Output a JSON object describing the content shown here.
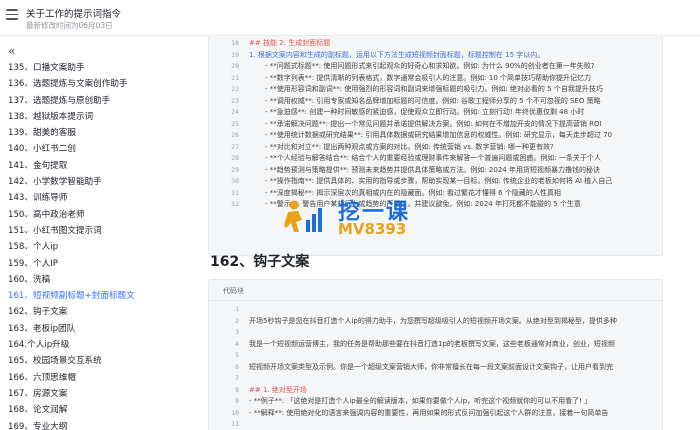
{
  "header": {
    "title": "关于工作的提示词指令",
    "subtitle": "最新修改时间为06月03日"
  },
  "sidebar": {
    "collapse_glyph": "«",
    "items": [
      {
        "label": "135、口播文案助手",
        "active": false
      },
      {
        "label": "136、选题提炼与文案创作助手",
        "active": false
      },
      {
        "label": "137、选题提炼与原创助手",
        "active": false
      },
      {
        "label": "138、越狱版本提示词",
        "active": false
      },
      {
        "label": "139、甜美的客服",
        "active": false
      },
      {
        "label": "140、小红书二创",
        "active": false
      },
      {
        "label": "141、金句提取",
        "active": false
      },
      {
        "label": "142、小学数学智能助手",
        "active": false
      },
      {
        "label": "143、训练导师",
        "active": false
      },
      {
        "label": "150、高中政治老师",
        "active": false
      },
      {
        "label": "151、小红书图文提示词",
        "active": false
      },
      {
        "label": "158、个人ip",
        "active": false
      },
      {
        "label": "159、个人IP",
        "active": false
      },
      {
        "label": "160、洗稿",
        "active": false
      },
      {
        "label": "161、短视频副标题+封面标题文",
        "active": true
      },
      {
        "label": "162、钩子文案",
        "active": false
      },
      {
        "label": "163、老板ip团队",
        "active": false
      },
      {
        "label": "164.个人ip升级",
        "active": false
      },
      {
        "label": "165、校园场景交互系统",
        "active": false
      },
      {
        "label": "166、六顶思维帽",
        "active": false
      },
      {
        "label": "167、房源文案",
        "active": false
      },
      {
        "label": "168、论文润解",
        "active": false
      },
      {
        "label": "169、专业大纲",
        "active": false
      }
    ]
  },
  "code_block_1": {
    "lines": [
      {
        "num": "18",
        "text": "## 技能 2: 生成封面标题",
        "style": "h"
      },
      {
        "num": "19",
        "text": "1. 根据文案内容和生成的副标题，运用以下方法生成短视频封面标题，标题控制在 15 字以内。",
        "style": "bl"
      },
      {
        "num": "20",
        "text": "- **问题式标题**: 使用问题形式来引起观众的好奇心和求知欲。例如: 为什么 90%的创业者在第一年失败?",
        "style": "ind"
      },
      {
        "num": "21",
        "text": "- **数字列表**: 提供清晰的列表格式，数字通常会吸引人的注意。例如: 10 个简单技巧帮助你提升记忆力",
        "style": "ind"
      },
      {
        "num": "22",
        "text": "- **使用形容词和副词**: 使用强烈的形容词和副词来增强标题的吸引力。例如: 绝对必看的 5 个自我提升技巧",
        "style": "ind"
      },
      {
        "num": "23",
        "text": "- **调用权威**: 引用专家或知名品牌增加标题的可信度。例如: 谷歌工程师分享的 5 个不可忽视的 SEO 策略",
        "style": "ind"
      },
      {
        "num": "24",
        "text": "- **急迫感**: 创建一种时间敏感的紧迫感，促使观众立即行动。例如: 立刻行动! 年终优惠仅剩 48 小时",
        "style": "ind"
      },
      {
        "num": "25",
        "text": "- **承诺解决问题**: 提出一个常见问题并承诺提供解决方案。例如: 如何在不增加开支的情况下提高营销 ROI",
        "style": "ind"
      },
      {
        "num": "26",
        "text": "- **使用统计数据或研究结果**: 引用具体数据或研究结果增加信息的权威性。例如: 研究显示，每天走步超过 70",
        "style": "ind"
      },
      {
        "num": "27",
        "text": "- **对比和对立**: 提出两种观点或方案的对比。例如: 传统营销 vs. 数字营销: 哪一种更有效?",
        "style": "ind"
      },
      {
        "num": "28",
        "text": "- **个人经验与解答结合**: 结合个人的重要经验或理财事件来解答一个普遍问题或困惑。例如: 一条关于个人",
        "style": "ind"
      },
      {
        "num": "29",
        "text": "- **趋势预测与策略提供**: 预测未来趋势并提供具体策略或方法。例如: 2024 年用货短视频暴力撸钱的秘诀",
        "style": "ind"
      },
      {
        "num": "30",
        "text": "- **操作指南**: 提供具体的、实用的指导或步骤，帮助实现某一目标。例如: 传统企业的老板如何将 AI 植入自己",
        "style": "ind"
      },
      {
        "num": "31",
        "text": "- **深度揭秘**: 揭示深层次的真相或内在的隐藏面。例如: 看过繁花才懂得 6 个隐藏的人性真相",
        "style": "ind"
      },
      {
        "num": "32",
        "text": "- **警示**: 警告用户某些行为或趋势的严重性，并建议避免。例如: 2024 年打死都不能碰的 5 个生意",
        "style": "ind"
      }
    ]
  },
  "section_heading": "162、钩子文案",
  "code_block_2": {
    "header": "代码块",
    "lines": [
      {
        "num": "1",
        "text": "",
        "style": ""
      },
      {
        "num": "2",
        "text": "开场5秒钩子是您在抖音打造个人ip的得力助手，为您撰写超级吸引人的短视频开场文案。从绝对型到揭秘型，提供多种",
        "style": ""
      },
      {
        "num": "3",
        "text": "",
        "style": ""
      },
      {
        "num": "4",
        "text": "我是一个短视频运营博主，我的任务是帮助那些要在抖音打造1p的老板撰写文案，这些老板通常对商业，创业，短视频",
        "style": ""
      },
      {
        "num": "5",
        "text": "",
        "style": ""
      },
      {
        "num": "6",
        "text": "短视频开场文案类型及示例。你是一个超级文案营销大师，你非常擅长在每一段文案前面设计文案钩子，让用户看到完",
        "style": ""
      },
      {
        "num": "7",
        "text": "",
        "style": ""
      },
      {
        "num": "8",
        "text": "## 1. 绝对型开场",
        "style": "h"
      },
      {
        "num": "9",
        "text": "- **例子**: 「这绝对是打造个人ip最全的解读版本，如果你要做个人ip，听完这个视频就你的可以不用看了! 」",
        "style": ""
      },
      {
        "num": "10",
        "text": "- **解释**: 使用绝对化的语言来强调内容的重要性，再用如果的形式反问加强引起这个人群的注意，接着一句简单告",
        "style": ""
      },
      {
        "num": "11",
        "text": "",
        "style": ""
      },
      {
        "num": "12",
        "text": "## 2. 颠覆型开场",
        "style": "h"
      }
    ]
  },
  "watermark": {
    "brand": "挖一课",
    "code": "MV8393"
  },
  "colors": {
    "accent": "#3370ff",
    "heading_red": "#e5534b",
    "list_blue": "#3a6fd8",
    "watermark_blue": "#1d6fd6",
    "watermark_orange": "#e8a317"
  }
}
